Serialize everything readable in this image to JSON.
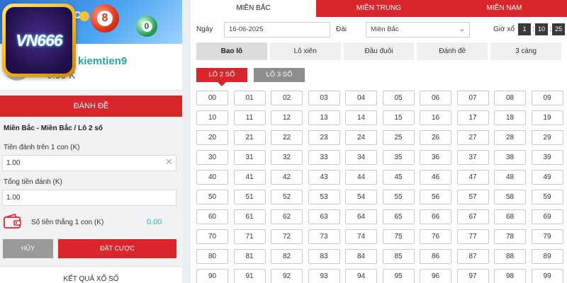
{
  "banner": {
    "letter": "c",
    "ball_red": "8",
    "ball_green": "0"
  },
  "logo": {
    "text": "VN666"
  },
  "user": {
    "name": "kiemtien9",
    "balance": "0.00 K"
  },
  "left": {
    "action_title": "ĐÁNH ĐỀ",
    "form_title": "Miền Bắc - Miền Bắc / Lô 2 số",
    "stake_label": "Tiền đánh trên 1 con (K)",
    "stake_value": "1.00",
    "total_label": "Tổng tiền đánh (K)",
    "total_value": "1.00",
    "win_label": "Số tiền thắng 1 con (K)",
    "win_value": "0.00",
    "cancel_label": "HỦY",
    "bet_label": "ĐẶT CƯỢC",
    "results_title": "KẾT QUẢ XỔ SỐ"
  },
  "region_tabs": [
    "MIỀN BẮC",
    "MIỀN TRUNG",
    "MIỀN NAM"
  ],
  "filters": {
    "date_label": "Ngày",
    "date_value": "16-06-2025",
    "station_label": "Đài",
    "station_value": "Miền Bắc",
    "time_label": "Giờ xổ",
    "time_h": "1",
    "time_m": "10",
    "time_s": "25"
  },
  "bet_types": [
    "Bao lô",
    "Lô xiên",
    "Đầu đuôi",
    "Đánh đề",
    "3 càng"
  ],
  "sub_tabs": [
    "LÔ 2 SỐ",
    "LÔ 3 SỐ"
  ],
  "numbers": [
    "00",
    "01",
    "02",
    "03",
    "04",
    "05",
    "06",
    "07",
    "08",
    "09",
    "10",
    "11",
    "12",
    "13",
    "14",
    "15",
    "16",
    "17",
    "18",
    "19",
    "20",
    "21",
    "22",
    "23",
    "24",
    "25",
    "26",
    "27",
    "28",
    "29",
    "30",
    "31",
    "32",
    "33",
    "34",
    "35",
    "36",
    "37",
    "38",
    "39",
    "40",
    "41",
    "42",
    "43",
    "44",
    "45",
    "46",
    "47",
    "48",
    "49",
    "50",
    "51",
    "52",
    "53",
    "54",
    "55",
    "56",
    "57",
    "58",
    "59",
    "60",
    "61",
    "62",
    "63",
    "64",
    "65",
    "66",
    "67",
    "68",
    "69",
    "70",
    "71",
    "72",
    "73",
    "74",
    "75",
    "76",
    "77",
    "78",
    "79",
    "80",
    "81",
    "82",
    "83",
    "84",
    "85",
    "86",
    "87",
    "88",
    "89",
    "90",
    "91",
    "92",
    "93",
    "94",
    "95",
    "96",
    "97",
    "98",
    "99"
  ],
  "colors": {
    "brand_red": "#d9262c",
    "accent_teal": "#22a7a1"
  }
}
